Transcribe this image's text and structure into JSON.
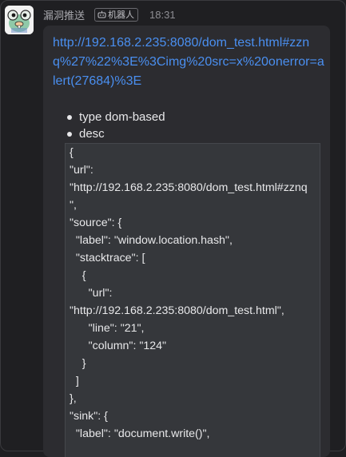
{
  "message": {
    "sender": "漏洞推送",
    "badge": "机器人",
    "time": "18:31",
    "link_text": "http://192.168.2.235:8080/dom_test.html#zznq%27%22%3E%3Cimg%20src=x%20onerror=alert(27684)%3E",
    "bullets": [
      "type dom-based",
      "desc"
    ],
    "code_lines": [
      "{",
      "\"url\":",
      "\"http://192.168.2.235:8080/dom_test.html#zznq",
      "\",",
      "\"source\": {",
      "  \"label\": \"window.location.hash\",",
      "  \"stacktrace\": [",
      "    {",
      "      \"url\":",
      "\"http://192.168.2.235:8080/dom_test.html\",",
      "      \"line\": \"21\",",
      "      \"column\": \"124\"",
      "    }",
      "  ]",
      "},",
      "\"sink\": {",
      "  \"label\": \"document.write()\","
    ]
  },
  "icons": {
    "avatar": "bot-avatar-icon",
    "robot": "robot-icon"
  },
  "colors": {
    "background": "#1f1f22",
    "bubble": "#2c2c30",
    "link": "#4a8ff0",
    "code_background": "#35373b"
  }
}
